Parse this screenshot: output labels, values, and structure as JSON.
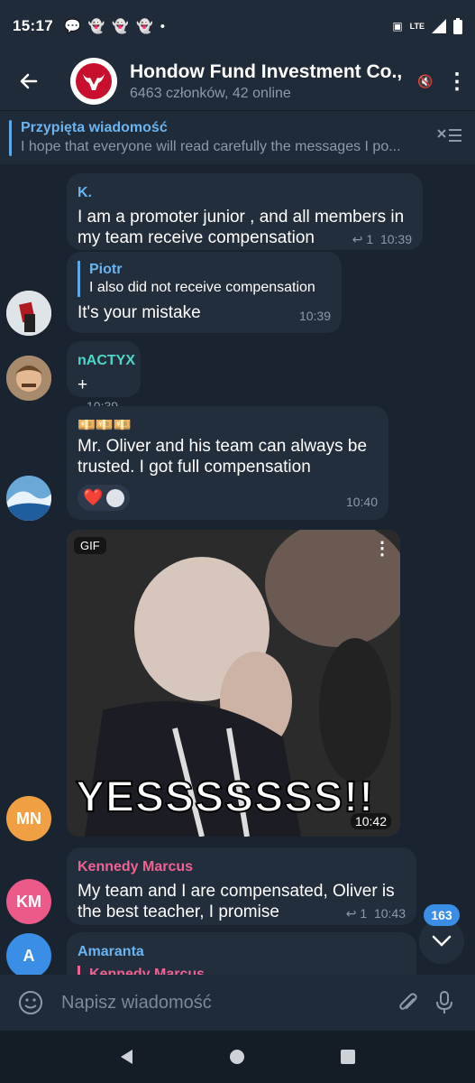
{
  "status_bar": {
    "time": "15:17",
    "notifications": [
      "chat-bubble-icon",
      "snapchat-icon",
      "snapchat-icon",
      "snapchat-icon"
    ],
    "dot": "•",
    "network": "LTE"
  },
  "header": {
    "title": "Hondow Fund Investment Co.,",
    "subtitle": "6463 członków, 42 online"
  },
  "pinned": {
    "title": "Przypięta wiadomość",
    "message": "I hope that everyone will read carefully the messages I po..."
  },
  "messages": [
    {
      "sender": "K.",
      "sender_color": "#6cb4f0",
      "text": "I am a promoter junior , and all members in my team receive compensation",
      "reply_count": "1",
      "time": "10:39"
    },
    {
      "reply_to": "Piotr",
      "reply_text": "I also did not receive compensation",
      "text": "It's your mistake",
      "time": "10:39"
    },
    {
      "sender": "nACTYX",
      "sender_color": "#4fd6c8",
      "text": "+",
      "time": "10:39"
    },
    {
      "emoji": "💴💴💴",
      "text": "Mr. Oliver and his team can always be trusted. I got full compensation",
      "reaction": "❤️",
      "time": "10:40"
    },
    {
      "type": "gif",
      "badge": "GIF",
      "caption": "YESSSSSSS!!",
      "time": "10:42",
      "avatar_initials": "MN",
      "avatar_color": "#f0a043"
    },
    {
      "sender": "Kennedy Marcus",
      "sender_color": "#f06292",
      "text": "My team and I are compensated, Oliver is the best teacher, I promise",
      "reply_count": "1",
      "time": "10:43",
      "avatar_initials": "KM",
      "avatar_color": "#ec5a8a"
    },
    {
      "sender": "Amaranta",
      "sender_color": "#6cb4f0",
      "reply_to": "Kennedy Marcus",
      "avatar_initials": "A",
      "avatar_color": "#3a8ee6"
    }
  ],
  "unread_count": "163",
  "input": {
    "placeholder": "Napisz wiadomość"
  }
}
